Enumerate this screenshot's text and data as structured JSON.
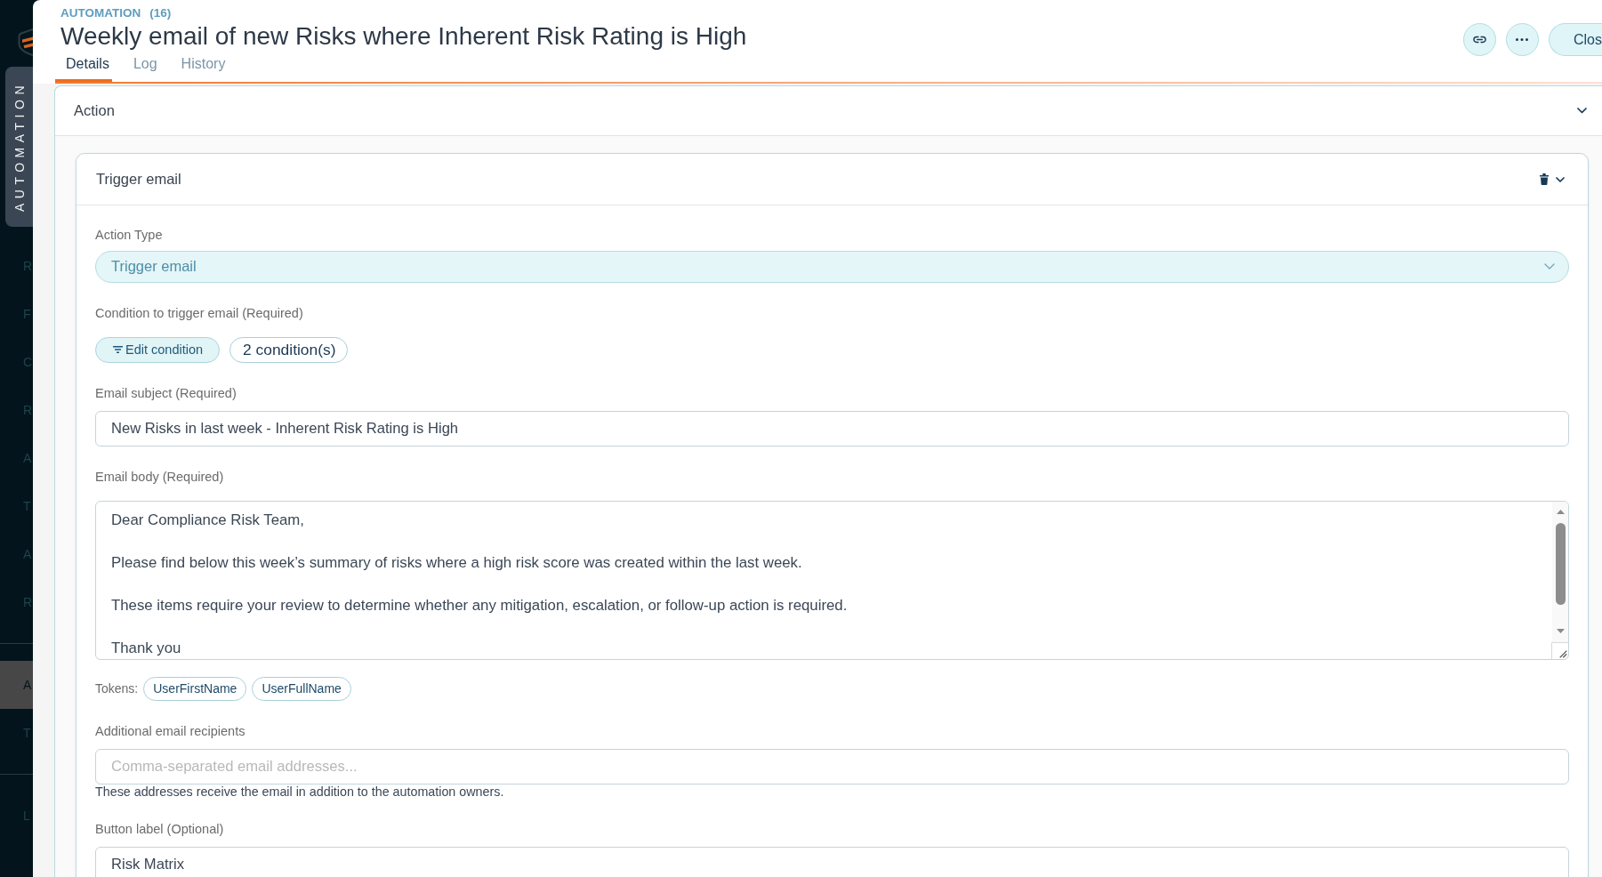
{
  "sidebar": {
    "tab": "AUTOMATION",
    "groups": [
      {
        "items": [
          {
            "label": "R",
            "selected": false
          },
          {
            "label": "F",
            "selected": false
          },
          {
            "label": "C",
            "selected": false
          },
          {
            "label": "R",
            "selected": false
          },
          {
            "label": "A",
            "selected": false
          },
          {
            "label": "T",
            "selected": false
          },
          {
            "label": "A",
            "selected": false
          },
          {
            "label": "R",
            "selected": false
          }
        ]
      },
      {
        "items": [
          {
            "label": "A",
            "selected": true
          },
          {
            "label": "T",
            "selected": false
          }
        ]
      },
      {
        "items": [
          {
            "label": "L",
            "selected": false
          }
        ]
      }
    ]
  },
  "header": {
    "section": "AUTOMATION",
    "count": "(16)",
    "title": "Weekly email of new Risks where Inherent Risk Rating is High",
    "tabs": [
      {
        "label": "Details",
        "selected": true
      },
      {
        "label": "Log",
        "selected": false
      },
      {
        "label": "History",
        "selected": false
      }
    ],
    "close_button": "Clos"
  },
  "action_section": {
    "title": "Action",
    "action_card": {
      "title": "Trigger email",
      "fields": [
        {
          "kind": "select",
          "label": "Action Type",
          "value": "Trigger email"
        },
        {
          "kind": "conditions",
          "label": "Condition to trigger email (Required)",
          "button": "Edit condition",
          "summary": "2 condition(s)"
        },
        {
          "kind": "text",
          "label": "Email subject (Required)",
          "value": "New Risks in last week - Inherent Risk Rating is High"
        },
        {
          "kind": "textarea",
          "label": "Email body (Required)",
          "value": "Dear Compliance Risk Team,\n\nPlease find below this week’s summary of risks where a high risk score was created within the last week.\n\nThese items require your review to determine whether any mitigation, escalation, or follow-up action is required.\n\nThank you",
          "tokens_label": "Tokens:",
          "tokens": [
            "UserFirstName",
            "UserFullName"
          ]
        },
        {
          "kind": "text",
          "label": "Additional email recipients",
          "placeholder": "Comma-separated email addresses...",
          "help": "These addresses receive the email in addition to the automation owners."
        },
        {
          "kind": "text",
          "label": "Button label (Optional)",
          "value": "Risk Matrix"
        }
      ]
    }
  }
}
